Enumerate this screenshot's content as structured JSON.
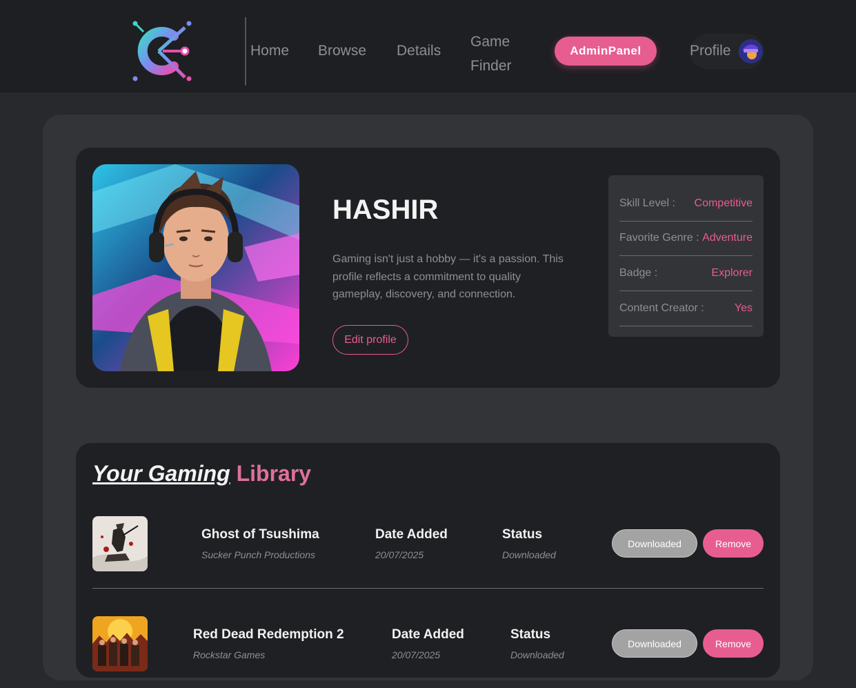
{
  "nav": {
    "links": [
      "Home",
      "Browse",
      "Details",
      "Game Finder"
    ],
    "admin_label": "AdminPanel",
    "profile_label": "Profile"
  },
  "profile": {
    "username": "HASHIR",
    "bio": "Gaming isn't just a hobby — it's a passion. This profile reflects a commitment to quality gameplay, discovery, and connection.",
    "edit_label": "Edit profile",
    "stats": [
      {
        "key": "Skill Level :",
        "value": "Competitive"
      },
      {
        "key": "Favorite Genre :",
        "value": "Adventure"
      },
      {
        "key": "Badge :",
        "value": "Explorer"
      },
      {
        "key": "Content Creator :",
        "value": "Yes"
      }
    ]
  },
  "library": {
    "title_part1": "Your Gaming",
    "title_part2": "Library",
    "date_header": "Date Added",
    "status_header": "Status",
    "download_label": "Downloaded",
    "remove_label": "Remove",
    "games": [
      {
        "name": "Ghost of Tsushima",
        "developer": "Sucker Punch Productions",
        "date": "20/07/2025",
        "status": "Downloaded"
      },
      {
        "name": "Red Dead Redemption 2",
        "developer": "Rockstar Games",
        "date": "20/07/2025",
        "status": "Downloaded"
      }
    ]
  },
  "colors": {
    "accent": "#e85d8f",
    "background": "#27292d",
    "card": "#1f2023",
    "panel": "#333437"
  }
}
